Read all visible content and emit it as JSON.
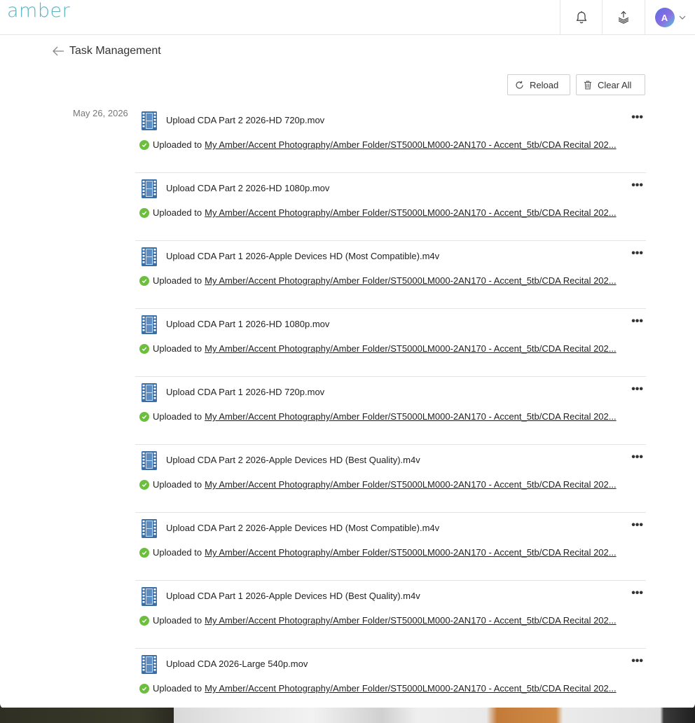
{
  "app": {
    "logo": "amber"
  },
  "header": {
    "icons": [
      "bell-icon",
      "stack-icon",
      "avatar"
    ],
    "avatar_initial": "A"
  },
  "page": {
    "title": "Task Management"
  },
  "toolbar": {
    "reload_label": "Reload",
    "clear_label": "Clear All"
  },
  "date_group": "May 26, 2026",
  "colors": {
    "brand": "#5bb3c4",
    "success": "#6cbf3d",
    "file_icon": "#3b6ea5"
  },
  "tasks": [
    {
      "name": "Upload CDA Part 2 2026-HD 720p.mov",
      "status": "Uploaded to",
      "path": "My Amber/Accent Photography/Amber Folder/ST5000LM000-2AN170 - Accent_5tb/CDA Recital 202..."
    },
    {
      "name": "Upload CDA Part 2 2026-HD 1080p.mov",
      "status": "Uploaded to",
      "path": "My Amber/Accent Photography/Amber Folder/ST5000LM000-2AN170 - Accent_5tb/CDA Recital 202..."
    },
    {
      "name": "Upload CDA Part 1 2026-Apple Devices HD (Most Compatible).m4v",
      "status": "Uploaded to",
      "path": "My Amber/Accent Photography/Amber Folder/ST5000LM000-2AN170 - Accent_5tb/CDA Recital 202..."
    },
    {
      "name": "Upload CDA Part 1 2026-HD 1080p.mov",
      "status": "Uploaded to",
      "path": "My Amber/Accent Photography/Amber Folder/ST5000LM000-2AN170 - Accent_5tb/CDA Recital 202..."
    },
    {
      "name": "Upload CDA Part 1 2026-HD 720p.mov",
      "status": "Uploaded to",
      "path": "My Amber/Accent Photography/Amber Folder/ST5000LM000-2AN170 - Accent_5tb/CDA Recital 202..."
    },
    {
      "name": "Upload CDA Part 2 2026-Apple Devices HD (Best Quality).m4v",
      "status": "Uploaded to",
      "path": "My Amber/Accent Photography/Amber Folder/ST5000LM000-2AN170 - Accent_5tb/CDA Recital 202..."
    },
    {
      "name": "Upload CDA Part 2 2026-Apple Devices HD (Most Compatible).m4v",
      "status": "Uploaded to",
      "path": "My Amber/Accent Photography/Amber Folder/ST5000LM000-2AN170 - Accent_5tb/CDA Recital 202..."
    },
    {
      "name": "Upload CDA Part 1 2026-Apple Devices HD (Best Quality).m4v",
      "status": "Uploaded to",
      "path": "My Amber/Accent Photography/Amber Folder/ST5000LM000-2AN170 - Accent_5tb/CDA Recital 202..."
    },
    {
      "name": "Upload CDA 2026-Large 540p.mov",
      "status": "Uploaded to",
      "path": "My Amber/Accent Photography/Amber Folder/ST5000LM000-2AN170 - Accent_5tb/CDA Recital 202..."
    }
  ]
}
